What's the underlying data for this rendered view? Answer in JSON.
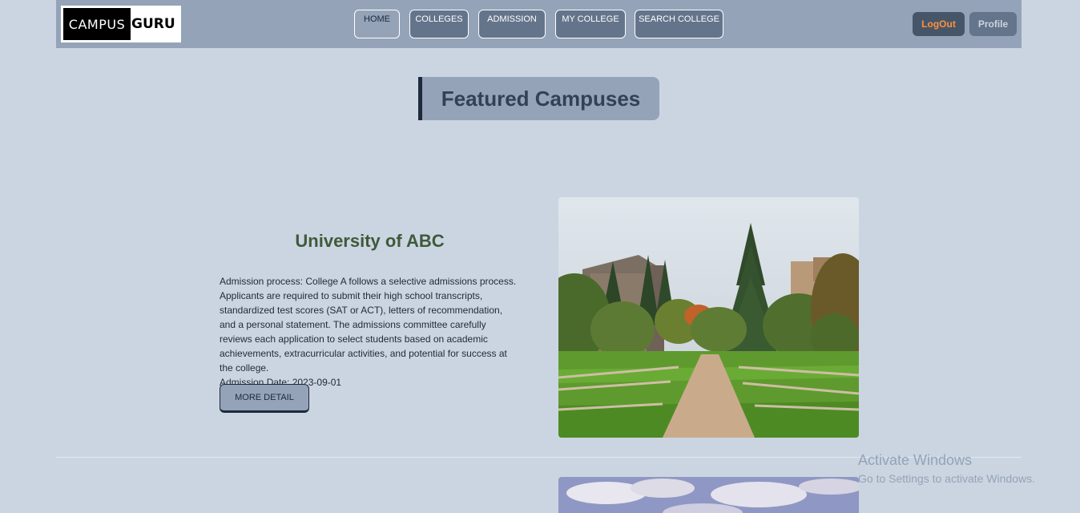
{
  "logo": {
    "part1": "CAMPUS",
    "part2": "GURU"
  },
  "nav": {
    "items": [
      {
        "label": "HOME",
        "active": true
      },
      {
        "label": "COLLEGES",
        "active": false
      },
      {
        "label": "ADMISSION",
        "active": false
      },
      {
        "label": "MY COLLEGE",
        "active": false
      },
      {
        "label": "SEARCH COLLEGE",
        "active": false
      }
    ],
    "logout_label": "LogOut",
    "profile_label": "Profile"
  },
  "featured": {
    "title": "Featured Campuses"
  },
  "college": {
    "name": "University of ABC",
    "description": "Admission process: College A follows a selective admissions process. Applicants are required to submit their high school transcripts, standardized test scores (SAT or ACT), letters of recommendation, and a personal statement. The admissions committee carefully reviews each application to select students based on academic achievements, extracurricular activities, and potential for success at the college.",
    "admission_date": "Admission Date: 2023-09-01",
    "button_label": "MORE DETAIL"
  },
  "watermark": {
    "line1": "Activate Windows",
    "line2": "Go to Settings to activate Windows."
  }
}
